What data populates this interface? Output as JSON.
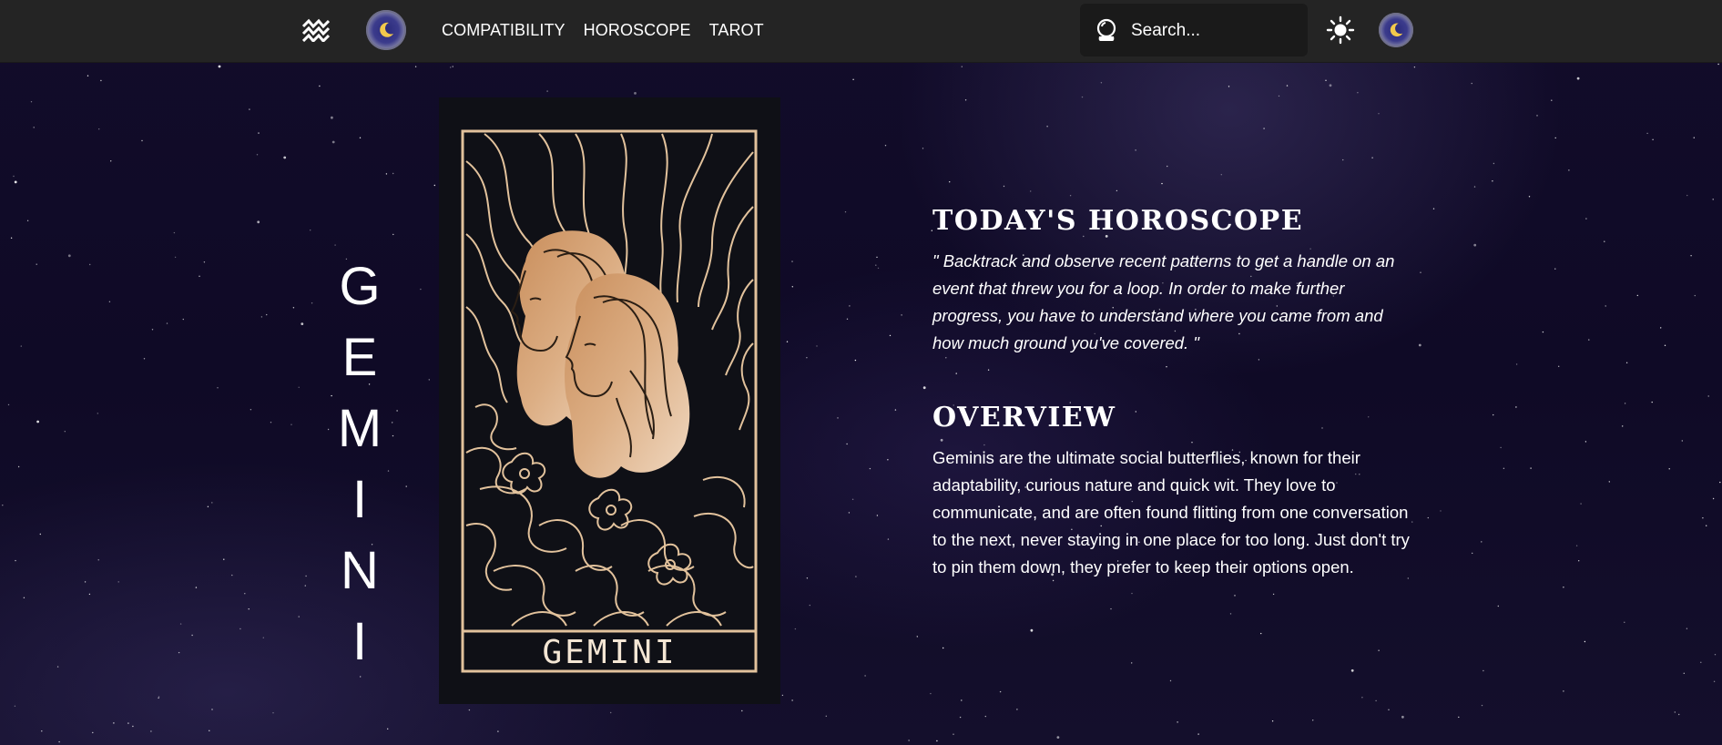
{
  "navbar": {
    "logo_icon": "aquarius-waves-icon",
    "avatar_icon": "crescent-moon-avatar",
    "links": [
      "COMPATIBILITY",
      "HOROSCOPE",
      "TAROT"
    ],
    "search": {
      "placeholder": "Search...",
      "icon": "crystal-ball-icon"
    },
    "theme_toggle_icon": "sun-icon",
    "user_avatar_icon": "crescent-moon-avatar"
  },
  "sign": {
    "letters": [
      "G",
      "E",
      "M",
      "I",
      "N",
      "I"
    ],
    "card_label": "GEMINI"
  },
  "horoscope": {
    "title": "TODAY'S HOROSCOPE",
    "text": "\" Backtrack and observe recent patterns to get a handle on an event that threw you for a loop. In order to make further progress, you have to understand where you came from and how much ground you've covered. \""
  },
  "overview": {
    "title": "OVERVIEW",
    "text": "Geminis are the ultimate social butterflies, known for their adaptability, curious nature and quick wit. They love to communicate, and are often found flitting from one conversation to the next, never staying in one place for too long. Just don't try to pin them down, they prefer to keep their options open."
  },
  "colors": {
    "navbar": "#242424",
    "background": "#0f0a26",
    "card_background": "#0f1016",
    "card_line": "#e2c29c",
    "card_figure": "#d9a87c"
  }
}
